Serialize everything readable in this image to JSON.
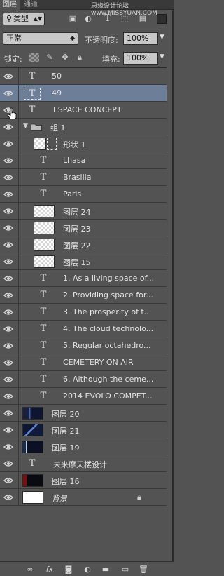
{
  "tabs": [
    {
      "label": "图层"
    },
    {
      "label": "通道"
    }
  ],
  "watermark": "思缘设计论坛 www.MISSYUAN.COM",
  "filter": {
    "kind_label": "类型"
  },
  "blend": {
    "mode": "正常",
    "opacity_label": "不透明度:",
    "opacity_value": "100%"
  },
  "locks": {
    "label": "锁定:",
    "fill_label": "填充:",
    "fill_value": "100%"
  },
  "layers": [
    {
      "name": "50",
      "kind": "text"
    },
    {
      "name": "49",
      "kind": "text",
      "selected": true
    },
    {
      "name": "I  SPACE CONCEPT",
      "kind": "text"
    },
    {
      "name": "组 1",
      "kind": "group"
    },
    {
      "name": "形状 1",
      "kind": "shape"
    },
    {
      "name": "Lhasa",
      "kind": "text"
    },
    {
      "name": "Brasilia",
      "kind": "text"
    },
    {
      "name": "Paris",
      "kind": "text"
    },
    {
      "name": "图层 24",
      "kind": "pixel"
    },
    {
      "name": "图层 23",
      "kind": "pixel"
    },
    {
      "name": "图层 22",
      "kind": "pixel"
    },
    {
      "name": "图层 15",
      "kind": "pixel"
    },
    {
      "name": "1. As a living space of...",
      "kind": "text"
    },
    {
      "name": "2. Providing space for...",
      "kind": "text"
    },
    {
      "name": "3. The prosperity of t...",
      "kind": "text"
    },
    {
      "name": "4. The cloud technolo...",
      "kind": "text"
    },
    {
      "name": "5. Regular octahedro...",
      "kind": "text"
    },
    {
      "name": "CEMETERY ON AIR",
      "kind": "text"
    },
    {
      "name": "6. Although the ceme...",
      "kind": "text"
    },
    {
      "name": "2014 EVOLO COMPET...",
      "kind": "text"
    },
    {
      "name": "图层 20",
      "kind": "image"
    },
    {
      "name": "图层 21",
      "kind": "image"
    },
    {
      "name": "图层 19",
      "kind": "image"
    },
    {
      "name": "未来摩天楼设计",
      "kind": "text"
    },
    {
      "name": "图层 16",
      "kind": "image"
    },
    {
      "name": "背景",
      "kind": "background"
    }
  ],
  "bottom": {
    "link": "∞",
    "fx": "fx"
  }
}
